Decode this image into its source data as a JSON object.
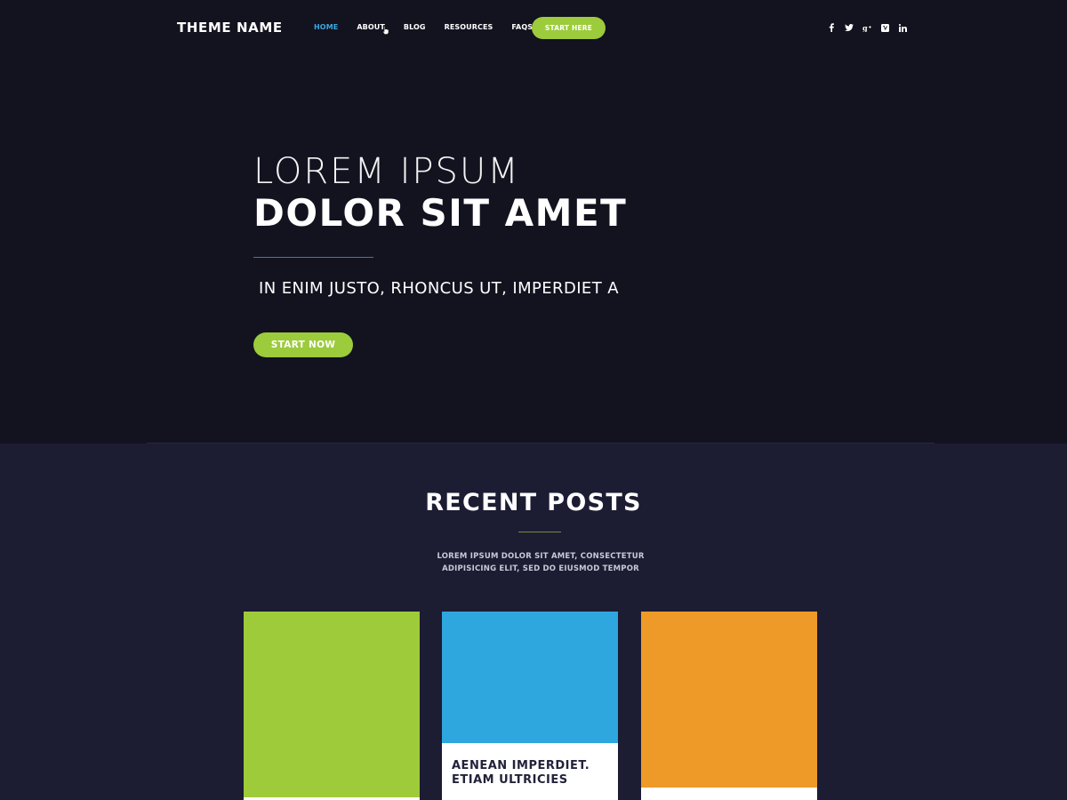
{
  "nav": {
    "logo": "THEME NAME",
    "items": [
      {
        "label": "HOME",
        "active": true
      },
      {
        "label": "ABOUT",
        "active": false
      },
      {
        "label": "BLOG",
        "active": false
      },
      {
        "label": "RESOURCES",
        "active": false
      },
      {
        "label": "FAQS",
        "active": false
      }
    ],
    "cta_label": "START HERE",
    "social_icons": [
      "facebook-icon",
      "twitter-icon",
      "google-plus-icon",
      "vimeo-icon",
      "linkedin-icon"
    ]
  },
  "hero": {
    "line1": "LOREM IPSUM",
    "line2": "DOLOR SIT AMET",
    "subtitle": "IN ENIM JUSTO, RHONCUS UT, IMPERDIET A",
    "button_label": "START NOW"
  },
  "posts": {
    "title": "RECENT POSTS",
    "description_line1": "LOREM IPSUM DOLOR SIT AMET, CONSECTETUR",
    "description_line2": "ADIPISICING ELIT, SED DO EIUSMOD TEMPOR",
    "cards": [
      {
        "color": "#9ecb3a",
        "title": ""
      },
      {
        "color": "#2ea7de",
        "title_line1": "AENEAN IMPERDIET.",
        "title_line2": "ETIAM ULTRICIES"
      },
      {
        "color": "#ee9a28",
        "title": ""
      }
    ]
  },
  "colors": {
    "background": "#13121f",
    "section_background": "#1c1c33",
    "accent_green": "#9ccb3b",
    "accent_blue": "#3ba7e0",
    "accent_orange": "#ee9a28"
  }
}
